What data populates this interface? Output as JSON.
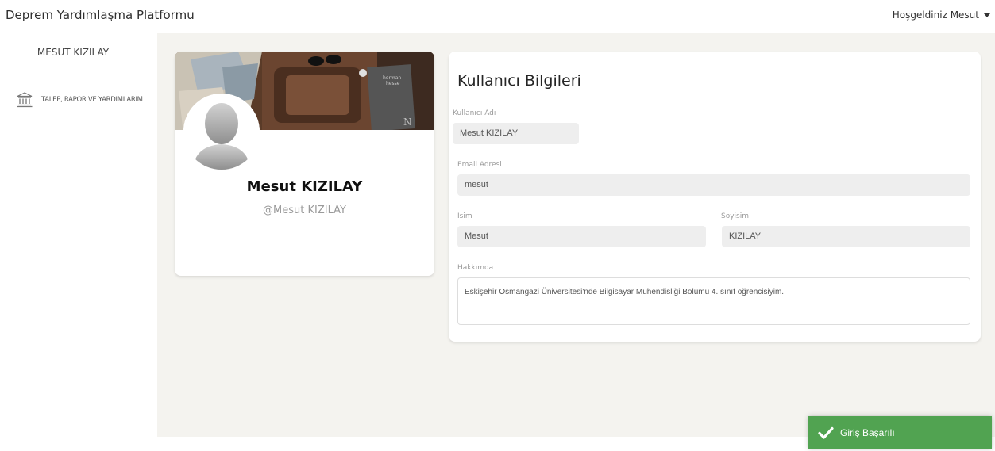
{
  "app": {
    "brand": "Deprem Yardımlaşma Platformu",
    "user_greeting": "Hoşgeldiniz Mesut"
  },
  "sidebar": {
    "user_name": "MESUT KIZILAY",
    "items": [
      {
        "label": "TALEP, RAPOR VE YARDIMLARIM",
        "icon": "bank-icon"
      }
    ]
  },
  "profile": {
    "name": "Mesut KIZILAY",
    "handle": "@Mesut KIZILAY",
    "cover_book_text": "herman hesse"
  },
  "user_info": {
    "title": "Kullanıcı Bilgileri",
    "username_label": "Kullanıcı Adı",
    "username_value": "Mesut KIZILAY",
    "email_label": "Email Adresi",
    "email_value": "mesut",
    "first_name_label": "İsim",
    "first_name_value": "Mesut",
    "last_name_label": "Soyisim",
    "last_name_value": "KIZILAY",
    "about_label": "Hakkımda",
    "about_value": "Eskişehir Osmangazi Üniversitesi'nde Bilgisayar Mühendisliği Bölümü 4. sınıf öğrencisiyim."
  },
  "toast": {
    "message": "Giriş Başarılı",
    "color": "#51a351"
  },
  "colors": {
    "main_bg": "#f4f3ef",
    "toast_green": "#51a351"
  }
}
